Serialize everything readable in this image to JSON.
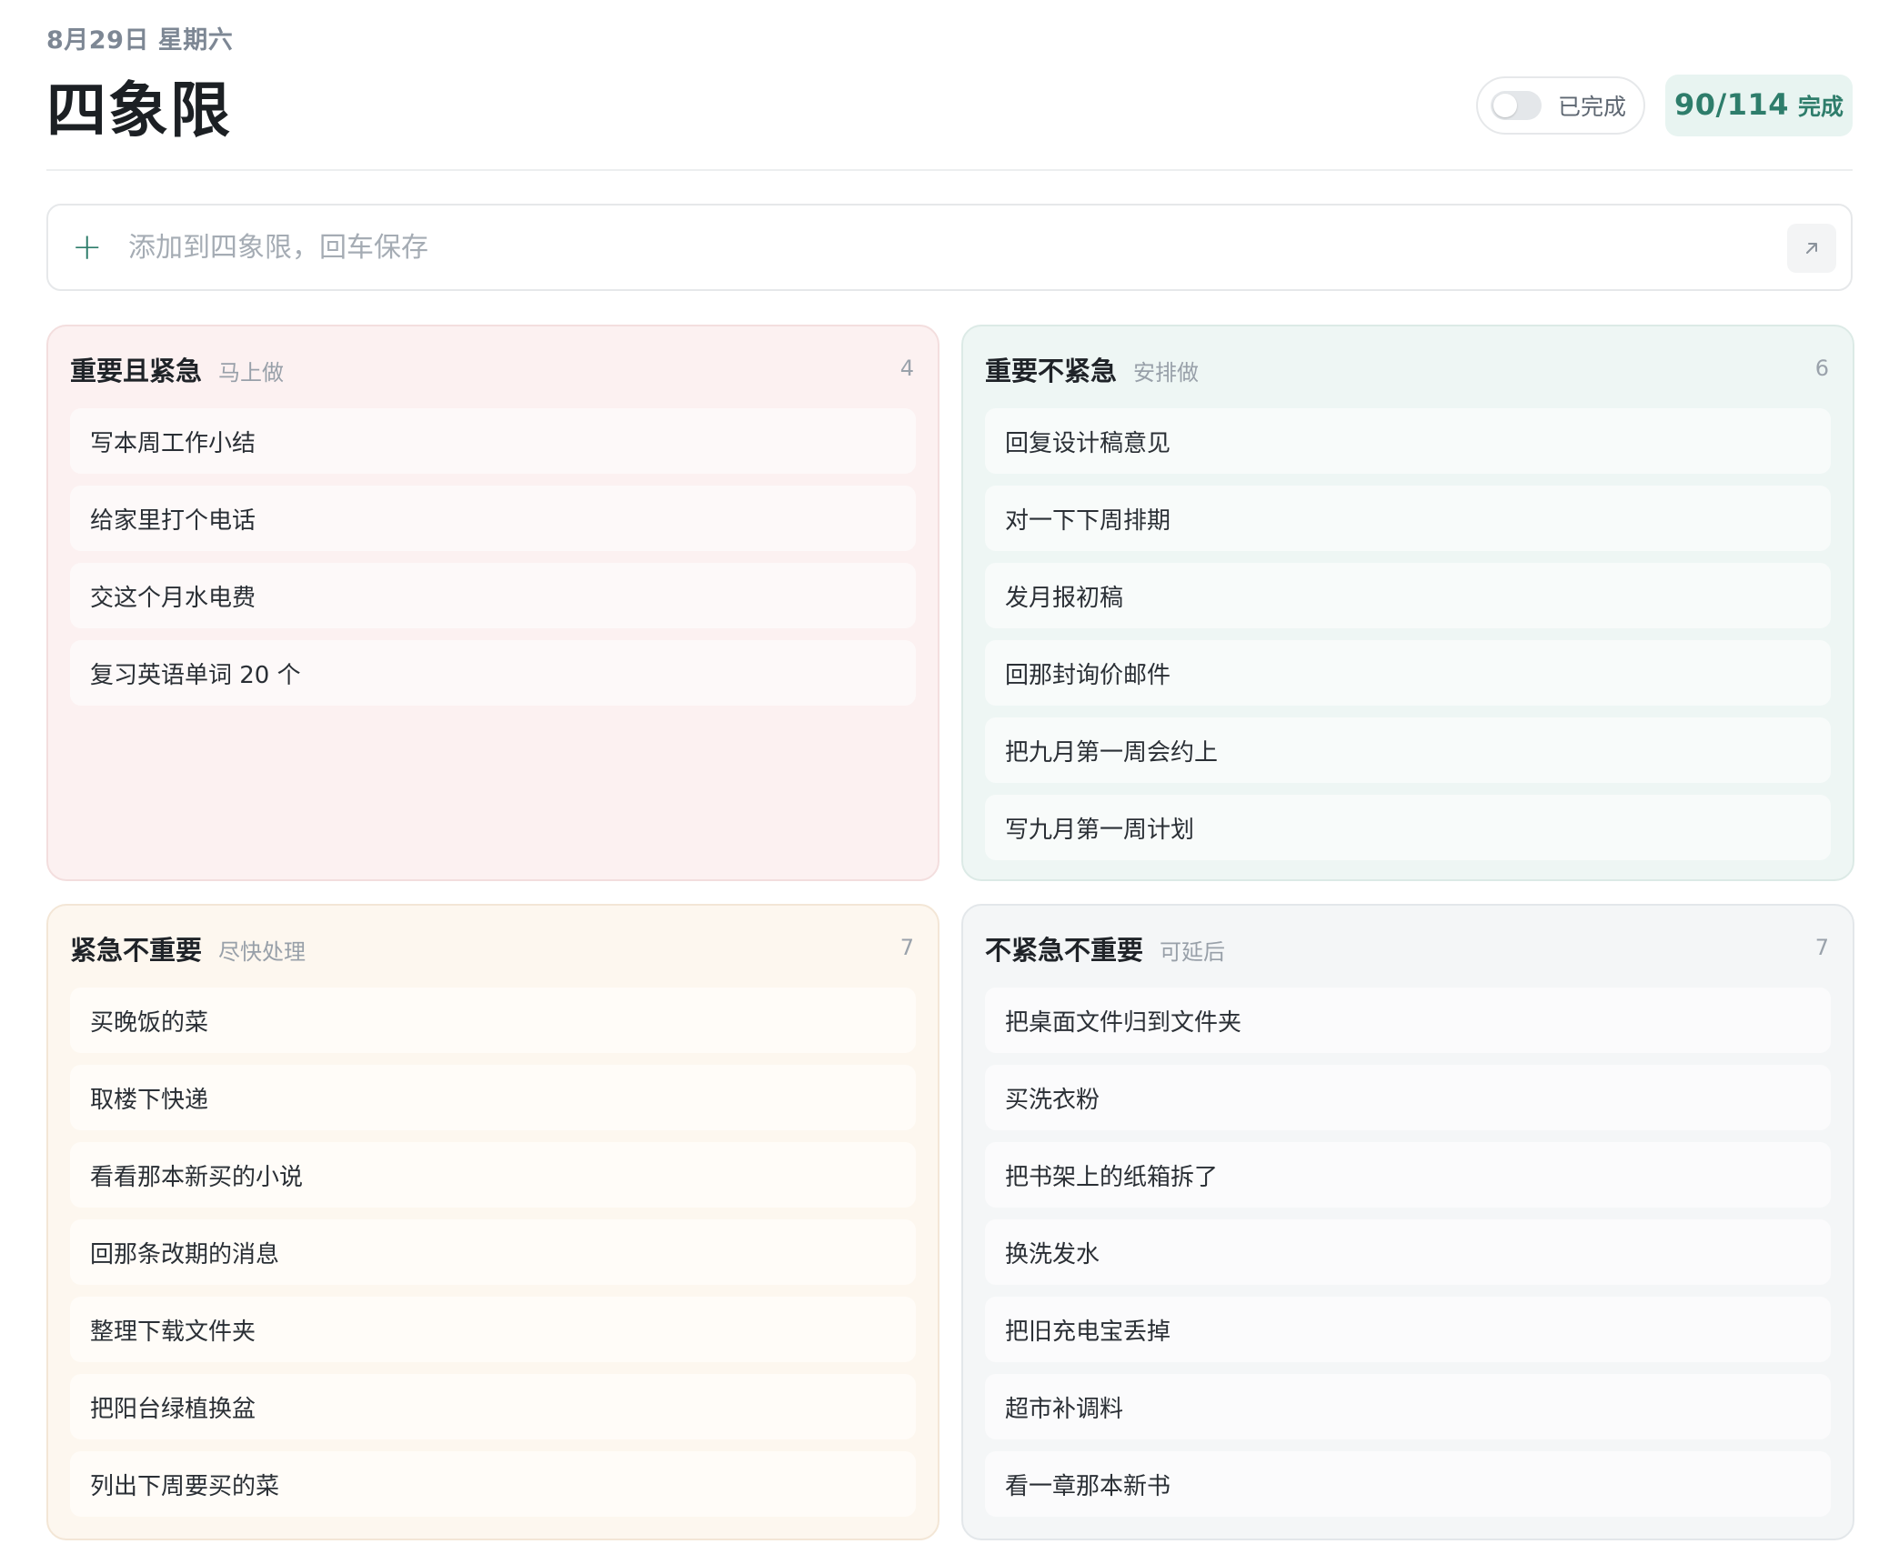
{
  "header": {
    "date": "8月29日 星期六",
    "title": "四象限",
    "toggle_label": "已完成",
    "progress_count": "90/114",
    "progress_label": "完成"
  },
  "add_bar": {
    "placeholder": "添加到四象限，回车保存"
  },
  "quadrants": [
    {
      "title": "重要且紧急",
      "subtitle": "马上做",
      "count": "4",
      "tasks": [
        "写本周工作小结",
        "给家里打个电话",
        "交这个月水电费",
        "复习英语单词 20 个"
      ]
    },
    {
      "title": "重要不紧急",
      "subtitle": "安排做",
      "count": "6",
      "tasks": [
        "回复设计稿意见",
        "对一下下周排期",
        "发月报初稿",
        "回那封询价邮件",
        "把九月第一周会约上",
        "写九月第一周计划"
      ]
    },
    {
      "title": "紧急不重要",
      "subtitle": "尽快处理",
      "count": "7",
      "tasks": [
        "买晚饭的菜",
        "取楼下快递",
        "看看那本新买的小说",
        "回那条改期的消息",
        "整理下载文件夹",
        "把阳台绿植换盆",
        "列出下周要买的菜"
      ]
    },
    {
      "title": "不紧急不重要",
      "subtitle": "可延后",
      "count": "7",
      "tasks": [
        "把桌面文件归到文件夹",
        "买洗衣粉",
        "把书架上的纸箱拆了",
        "换洗发水",
        "把旧充电宝丢掉",
        "超市补调料",
        "看一章那本新书"
      ]
    }
  ],
  "colors": {
    "accent": "#2e7d6b",
    "q1_bg": "#fcf1f1",
    "q2_bg": "#eef6f4",
    "q3_bg": "#fdf7ef",
    "q4_bg": "#f4f6f7"
  },
  "icons": {
    "add": "plus-icon",
    "expand": "arrow-up-right-icon"
  }
}
